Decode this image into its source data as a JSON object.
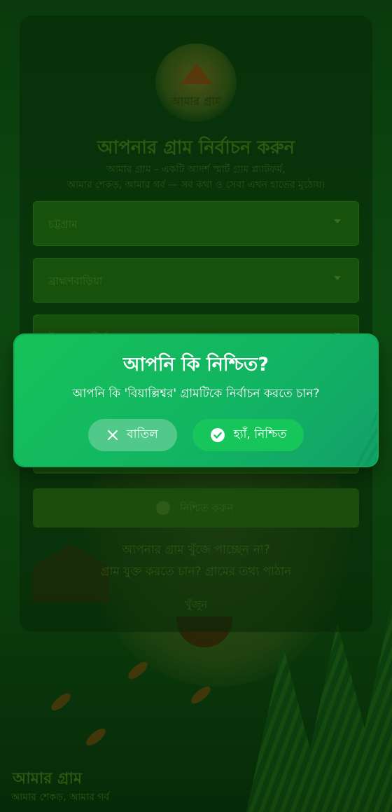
{
  "app": {
    "logo_text": "আমার গ্রাম"
  },
  "background": {
    "title": "আপনার গ্রাম নির্বাচন করুন",
    "subtitle_line1": "আমার গ্রাম – একটি আদর্শ স্মার্ট গ্রাম প্ল্যাটফর্ম,",
    "subtitle_line2": "আমার শেকড়, আমার গর্ব — সব কথা ও সেবা এখন হাতের মুঠোয়।",
    "select_division": "চট্টগ্রাম",
    "select_district": "ব্রাহ্মণবাড়িয়া",
    "select_upazila": "উপজেলা নির্বাচন করুন",
    "confirm_button": "নিশ্চিত করুন",
    "not_found_question": "আপনার গ্রাম খুঁজে পাচ্ছেন না?",
    "add_village_text": "গ্রাম যুক্ত করতে চান? গ্রামের তথ্য পাঠান",
    "search_link": "খুঁজুন",
    "footer_brand": "আমার গ্রাম",
    "footer_tagline": "আমার শেকড়, আমার গর্ব"
  },
  "modal": {
    "title": "আপনি কি নিশ্চিত?",
    "message": "আপনি কি 'বিয়াল্লিশ্বর' গ্রামটিকে নির্বাচন করতে চান?",
    "cancel_label": "বাতিল",
    "confirm_label": "হ্যাঁ, নিশ্চিত",
    "cancel_icon": "close-icon",
    "confirm_icon": "check-circle-icon"
  }
}
